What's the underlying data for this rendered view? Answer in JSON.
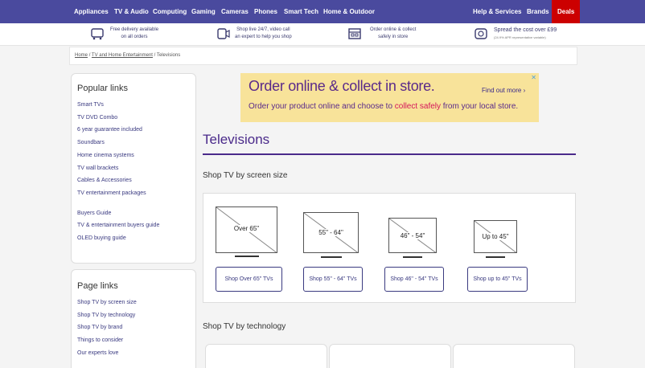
{
  "topnav": {
    "items": [
      "Appliances",
      "TV & Audio",
      "Computing",
      "Gaming",
      "Cameras",
      "Phones",
      "Smart Tech",
      "Home & Outdoor"
    ],
    "right": [
      "Help & Services",
      "Brands"
    ],
    "deals": "Deals"
  },
  "usps": [
    {
      "line1": "Free delivery available",
      "line2": "on all orders",
      "icon": "van-icon"
    },
    {
      "line1": "Shop live 24/7, video call",
      "line2": "an expert to help you shop",
      "icon": "video-call-icon"
    },
    {
      "line1": "Order online & collect",
      "line2": "safely in store",
      "icon": "store-icon"
    },
    {
      "line1": "Spread the cost over £99",
      "line2": "(24.9% APR representative variable)",
      "icon": "calculator-icon"
    }
  ],
  "breadcrumb": {
    "home": "Home",
    "sep": "/",
    "parent": "TV and Home Entertainment",
    "current": "Televisions"
  },
  "popular_links": {
    "title": "Popular links",
    "items": [
      "Smart TVs",
      "TV DVD Combo",
      "6 year guarantee included",
      "Soundbars",
      "Home cinema systems",
      "TV wall brackets",
      "Cables & Accessories",
      "TV entertainment packages"
    ],
    "guides": [
      "Buyers Guide",
      "TV & entertainment buyers guide",
      "OLED buying guide"
    ]
  },
  "page_links": {
    "title": "Page links",
    "items": [
      "Shop TV by screen size",
      "Shop TV by technology",
      "Shop TV by brand",
      "Things to consider",
      "Our experts love"
    ]
  },
  "banner": {
    "title": "Order online & collect in store.",
    "sub_before": "Order your product online and choose to ",
    "sub_highlight": "collect safely",
    "sub_after": " from your local store.",
    "cta": "Find out more ›",
    "close": "✕"
  },
  "page_title": "Televisions",
  "size_section": {
    "title": "Shop TV by screen size",
    "tvs": [
      {
        "label": "Over 65\"",
        "button": "Shop Over 65\" TVs"
      },
      {
        "label": "55\" - 64\"",
        "button": "Shop 55\" - 64\" TVs"
      },
      {
        "label": "46\" - 54\"",
        "button": "Shop 46\" - 54\" TVs"
      },
      {
        "label": "Up to 45\"",
        "button": "Shop up to 45\" TVs"
      }
    ]
  },
  "tech_section": {
    "title": "Shop TV by technology"
  },
  "colors": {
    "nav": "#4a4a9e",
    "deals": "#cc0000",
    "brand_purple": "#4a2a8a",
    "banner_bg": "#f8e39a",
    "highlight": "#d4145a"
  }
}
